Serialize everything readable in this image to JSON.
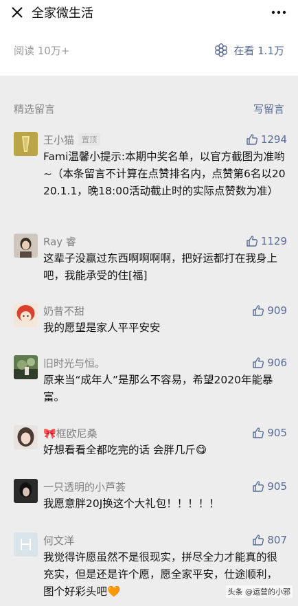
{
  "header": {
    "title": "全家微生活"
  },
  "stats": {
    "reads": "阅读 10万+",
    "watching": "在看 1.1万"
  },
  "comments_section": {
    "label": "精选留言",
    "write": "写留言"
  },
  "comments": [
    {
      "name": "王小猫",
      "badge": "置顶",
      "likes": "1294",
      "text": "Fami温馨小提示:本期中奖名单，以官方截图为准哟~（本条留言不计算在点赞排名内，点赞第6名以2020.1.1，晚18:00活动截止时的实际点赞数为准）"
    },
    {
      "name": "Ray 睿",
      "likes": "1129",
      "text": "这辈子没赢过东西啊啊啊啊，把好运都打在我身上吧，我能承受的住[福]"
    },
    {
      "name": "奶昔不甜",
      "likes": "909",
      "text": "我的愿望是家人平平安安"
    },
    {
      "name": "旧时光与恒。",
      "likes": "906",
      "text": "原来当“成年人”是那么不容易，希望2020年能暴富。"
    },
    {
      "name": "🎀框欧尼桑",
      "likes": "905",
      "text": "好想看看全都吃完的话 会胖几斤😋"
    },
    {
      "name": "一只透明的小芦荟",
      "likes": "905",
      "text": "我愿意胖20J换这个大礼包！！！！！"
    },
    {
      "name": "何文洋",
      "likes": "807",
      "text": "我觉得许愿虽然不是很现实，拼尽全力才能真的很充实，但是还是许个愿，愿全家平安，仕途顺利，图个好彩头吧🧡"
    }
  ],
  "watermark": "头条 @运营的小邪",
  "colors": {
    "link": "#576b95",
    "background": "#ededed"
  }
}
